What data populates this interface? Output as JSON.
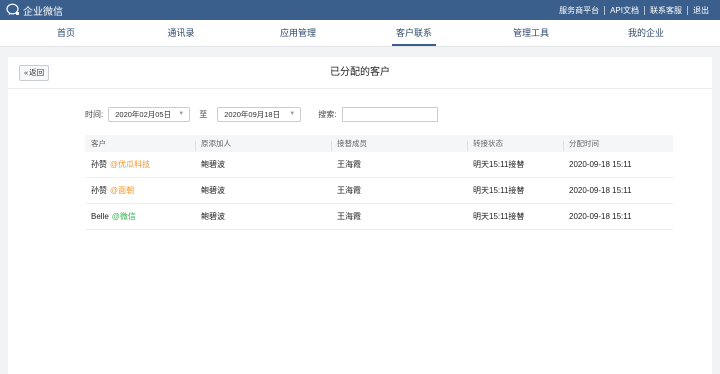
{
  "app": {
    "logo_text": "企业微信",
    "top_links": [
      "服务商平台",
      "API文档",
      "联系客服",
      "退出"
    ]
  },
  "nav": {
    "tabs": [
      {
        "label": "首页",
        "active": false
      },
      {
        "label": "通讯录",
        "active": false
      },
      {
        "label": "应用管理",
        "active": false
      },
      {
        "label": "客户联系",
        "active": true
      },
      {
        "label": "管理工具",
        "active": false
      },
      {
        "label": "我的企业",
        "active": false
      }
    ]
  },
  "page": {
    "back_label": "返回",
    "title": "已分配的客户"
  },
  "filters": {
    "time_label": "时间:",
    "start_date": "2020年02月05日",
    "to_label": "至",
    "end_date": "2020年09月18日",
    "search_label": "搜索:",
    "search_value": ""
  },
  "table": {
    "columns": [
      "客户",
      "原添加人",
      "接替成员",
      "转接状态",
      "分配时间"
    ],
    "rows": [
      {
        "customer": "孙赞",
        "tag": "@优瓜科技",
        "tag_color": "#f2962e",
        "original": "鲍碧波",
        "successor": "王海霞",
        "status": "明天15:11接替",
        "time": "2020-09-18 15:11"
      },
      {
        "customer": "孙赞",
        "tag": "@面朝",
        "tag_color": "#f2962e",
        "original": "鲍碧波",
        "successor": "王海霞",
        "status": "明天15:11接替",
        "time": "2020-09-18 15:11"
      },
      {
        "customer": "Belle",
        "tag": "@微信",
        "tag_color": "#2db84d",
        "original": "鲍碧波",
        "successor": "王海霞",
        "status": "明天15:11接替",
        "time": "2020-09-18 15:11"
      }
    ]
  },
  "colors": {
    "topbar": "#3a5f8c",
    "page_bg": "#f2f3f5",
    "tag_orange": "#f2962e",
    "tag_green": "#2db84d"
  }
}
